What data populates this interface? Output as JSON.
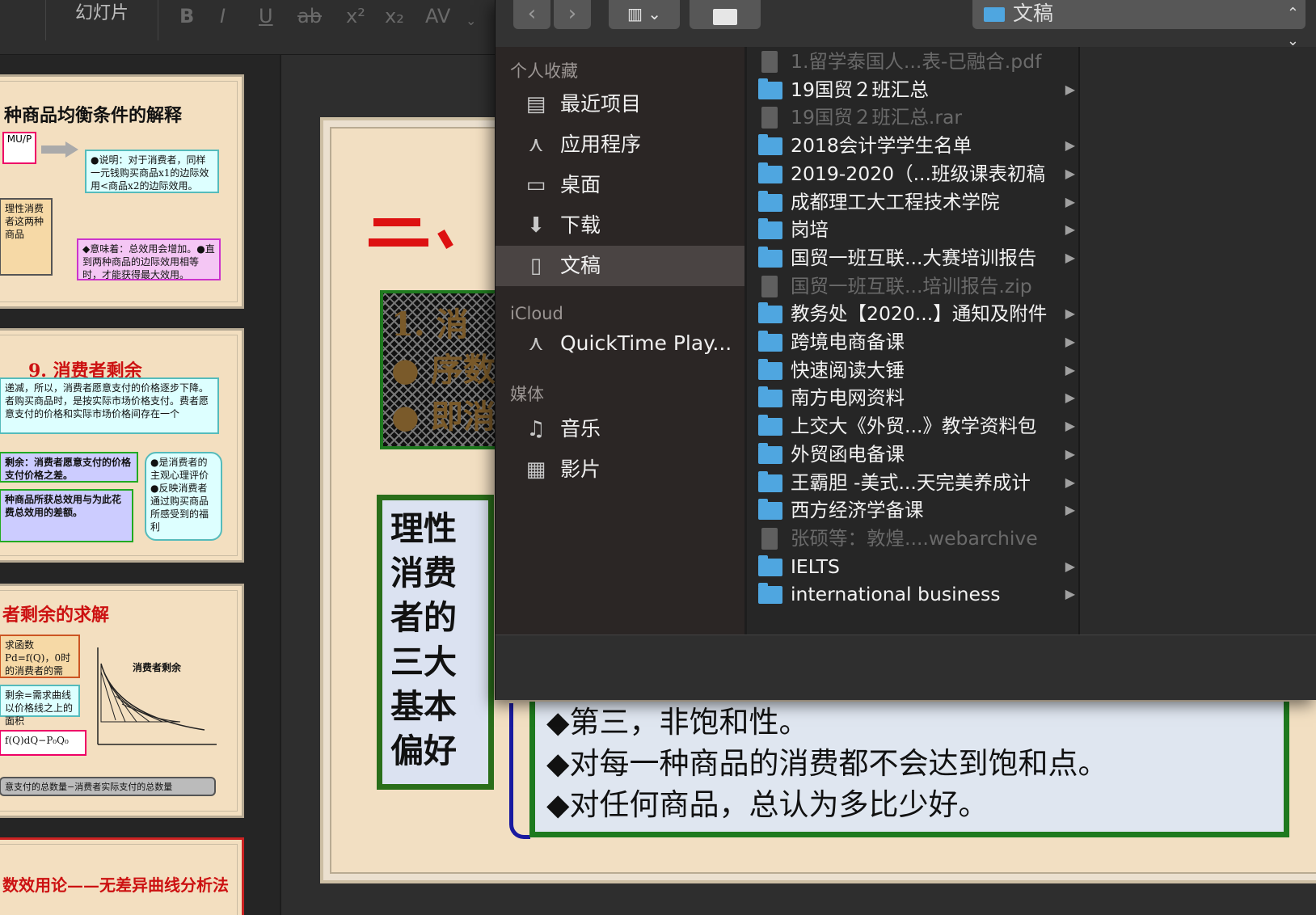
{
  "ppt": {
    "tab_label": "幻灯片",
    "format_buttons": [
      "B",
      "I",
      "U",
      "ab",
      "x²",
      "x₂",
      "AV"
    ]
  },
  "thumbnails": [
    {
      "title": "种商品均衡条件的解释",
      "box1": "●说明：对于消费者，同样一元钱购买商品x1的边际效用<商品x2的边际效用。",
      "box2": "理性消费者这两种商品",
      "box3": "◆意味着：总效用会增加。●直到两种商品的边际效用相等时，才能获得最大效用。"
    },
    {
      "title": "9. 消费者剩余",
      "box1": "递减，所以，消费者愿意支付的价格逐步下降。者购买商品时，是按实际市场价格支付。费者愿意支付的价格和实际市场价格间存在一个",
      "box2": "剩余：消费者愿意支付的价格支付价格之差。",
      "box3": "种商品所获总效用与为此花费总效用的差额。",
      "box4": "●是消费者的主观心理评价●反映消费者通过购买商品所感受到的福利"
    },
    {
      "title": "者剩余的求解",
      "box1": "求函数Pd=f(Q)，0时的消费者的需",
      "box2": "剩余=需求曲线以价格线之上的面积",
      "box3": "f(Q)dQ−P₀Q₀",
      "box4": "意支付的总数量−消费者实际支付的总数量",
      "chart_label": "消费者剩余"
    },
    {
      "title": "数效用论——无差异曲线分析法"
    }
  ],
  "slide": {
    "heading_char": "二、",
    "pattern_lines": [
      "1. 消",
      "● 序数",
      "● 即消"
    ],
    "vertical_text": "理性消费者的三大基本偏好",
    "bullets": [
      "◆第三，非饱和性。",
      "◆对每一种商品的消费都不会达到饱和点。",
      "◆对任何商品，总认为多比少好。"
    ]
  },
  "finder": {
    "location": "文稿",
    "sidebar": {
      "favorites_header": "个人收藏",
      "favorites": [
        {
          "label": "最近项目",
          "icon": "recents-icon"
        },
        {
          "label": "应用程序",
          "icon": "applications-icon"
        },
        {
          "label": "桌面",
          "icon": "desktop-icon"
        },
        {
          "label": "下载",
          "icon": "downloads-icon"
        },
        {
          "label": "文稿",
          "icon": "documents-icon",
          "selected": true
        }
      ],
      "icloud_header": "iCloud",
      "icloud": [
        {
          "label": "QuickTime Play...",
          "icon": "quicktime-icon"
        }
      ],
      "media_header": "媒体",
      "media": [
        {
          "label": "音乐",
          "icon": "music-icon"
        },
        {
          "label": "影片",
          "icon": "movies-icon"
        }
      ]
    },
    "files": [
      {
        "name": "1.留学泰国人...表-已融合.pdf",
        "type": "file",
        "dim": true
      },
      {
        "name": "19国贸２班汇总",
        "type": "folder"
      },
      {
        "name": "19国贸２班汇总.rar",
        "type": "file",
        "dim": true
      },
      {
        "name": "2018会计学学生名单",
        "type": "folder"
      },
      {
        "name": "2019-2020（...班级课表初稿",
        "type": "folder"
      },
      {
        "name": "成都理工大工程技术学院",
        "type": "folder"
      },
      {
        "name": "岗培",
        "type": "folder"
      },
      {
        "name": "国贸一班互联...大赛培训报告",
        "type": "folder"
      },
      {
        "name": "国贸一班互联...培训报告.zip",
        "type": "file",
        "dim": true
      },
      {
        "name": "教务处【2020...】通知及附件",
        "type": "folder"
      },
      {
        "name": "跨境电商备课",
        "type": "folder"
      },
      {
        "name": "快速阅读大锤",
        "type": "folder"
      },
      {
        "name": "南方电网资料",
        "type": "folder"
      },
      {
        "name": "上交大《外贸...》教学资料包",
        "type": "folder"
      },
      {
        "name": "外贸函电备课",
        "type": "folder"
      },
      {
        "name": "王霸胆 -美式...天完美养成计",
        "type": "folder"
      },
      {
        "name": "西方经济学备课",
        "type": "folder"
      },
      {
        "name": "张硕等：敦煌....webarchive",
        "type": "file",
        "dim": true
      },
      {
        "name": "IELTS",
        "type": "folder"
      },
      {
        "name": "international business",
        "type": "folder"
      }
    ]
  }
}
